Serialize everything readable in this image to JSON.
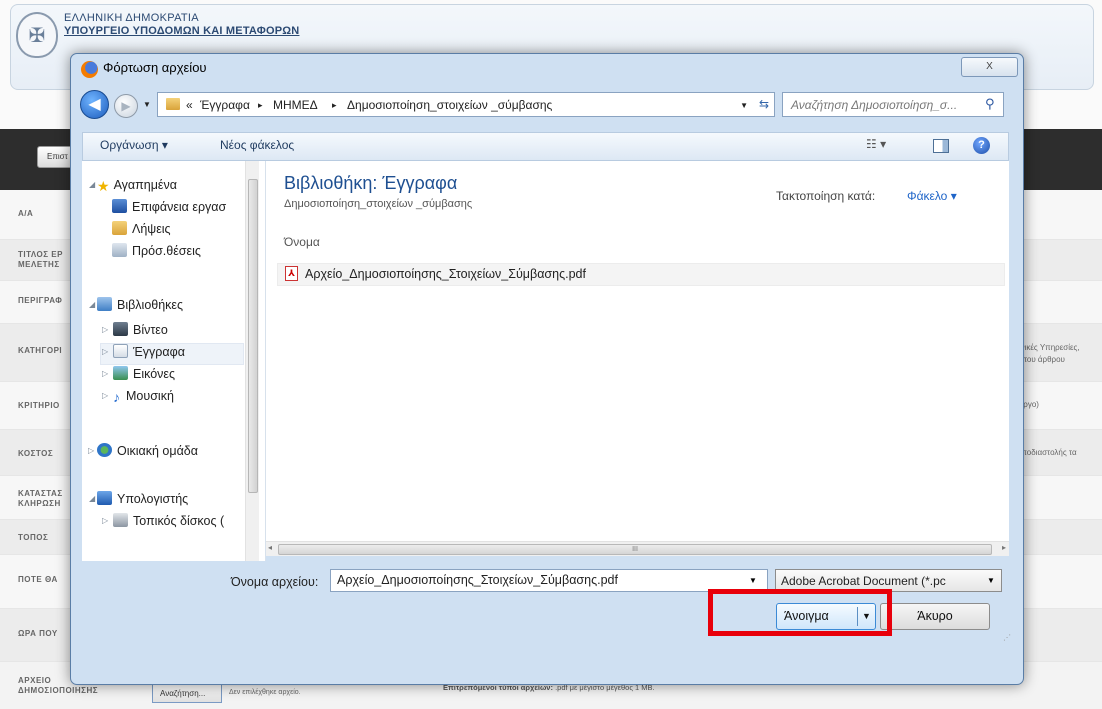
{
  "header": {
    "line1": "ΕΛΛΗΝΙΚΗ ΔΗΜΟΚΡΑΤΙΑ",
    "line2": "ΥΠΟΥΡΓΕΙΟ ΥΠΟΔΟΜΩΝ ΚΑΙ ΜΕΤΑΦΟΡΩΝ"
  },
  "background": {
    "button_label": "Επιστ",
    "rows": [
      {
        "label": "Α/Α"
      },
      {
        "label": "ΤΙΤΛΟΣ ΕΡ\nΜΕΛΕΤΗΣ"
      },
      {
        "label": "ΠΕΡΙΓΡΑΦ"
      },
      {
        "label": "ΚΑΤΗΓΟΡΙ",
        "text": "ενικές Υπηρεσίες,\nβ του άρθρου"
      },
      {
        "label": "ΚΡΙΤΗΡΙΟ",
        "text": "Έργο)"
      },
      {
        "label": "ΚΟΣΤΟΣ",
        "text": "υποδιαστολής τα"
      },
      {
        "label": "ΚΑΤΑΣΤΑΣ\nΚΛΗΡΩΣΗ"
      },
      {
        "label": "ΤΟΠΟΣ"
      },
      {
        "label": "ΠΟΤΕ ΘΑ"
      },
      {
        "label": "ΩΡΑ ΠΟΥ"
      }
    ],
    "file_row": {
      "label": "ΑΡΧΕΙΟ\nΔΗΜΟΣΙΟΠΟΙΗΣΗΣ",
      "browse_label": "Αναζήτηση...",
      "no_file": "Δεν επιλέχθηκε αρχείο.",
      "allowed_bold": "Επιτρεπόμενοι τύποι αρχείων:",
      "allowed_rest": ".pdf με μέγιστο μέγεθος 1 MB."
    }
  },
  "dialog": {
    "title": "Φόρτωση αρχείου",
    "close_label": "X",
    "address": {
      "prefix": "«",
      "crumbs": [
        "Έγγραφα",
        "ΜΗΜΕΔ",
        "Δημοσιοποίηση_στοιχείων _σύμβασης"
      ],
      "separator": "▸"
    },
    "search_placeholder": "Αναζήτηση Δημοσιοποίηση_σ...",
    "toolbar": {
      "organize": "Οργάνωση ▾",
      "new_folder": "Νέος φάκελος"
    },
    "nav": {
      "favorites": "Αγαπημένα",
      "desktop": "Επιφάνεια εργασ",
      "downloads": "Λήψεις",
      "recent": "Πρόσ.θέσεις",
      "libraries": "Βιβλιοθήκες",
      "videos": "Βίντεο",
      "documents": "Έγγραφα",
      "pictures": "Εικόνες",
      "music": "Μουσική",
      "homegroup": "Οικιακή ομάδα",
      "computer": "Υπολογιστής",
      "local_disk": "Τοπικός δίσκος ("
    },
    "content": {
      "library_title": "Βιβλιοθήκη: Έγγραφα",
      "library_sub": "Δημοσιοποίηση_στοιχείων _σύμβασης",
      "sort_label": "Τακτοποίηση κατά:",
      "sort_value": "Φάκελο ▾",
      "column_name": "Όνομα",
      "files": [
        "Αρχείο_Δημοσιοποίησης_Στοιχείων_Σύμβασης.pdf"
      ]
    },
    "filename_label": "Όνομα αρχείου:",
    "filename_value": "Αρχείο_Δημοσιοποίησης_Στοιχείων_Σύμβασης.pdf",
    "filetype_value": "Adobe Acrobat Document (*.pc",
    "open_label": "Άνοιγμα",
    "cancel_label": "Άκυρο",
    "scroll_mark": "III"
  },
  "colors": {
    "highlight_box": "#e8000b",
    "dark_bar": "#2d2d2d",
    "library_title": "#1e4f91"
  }
}
